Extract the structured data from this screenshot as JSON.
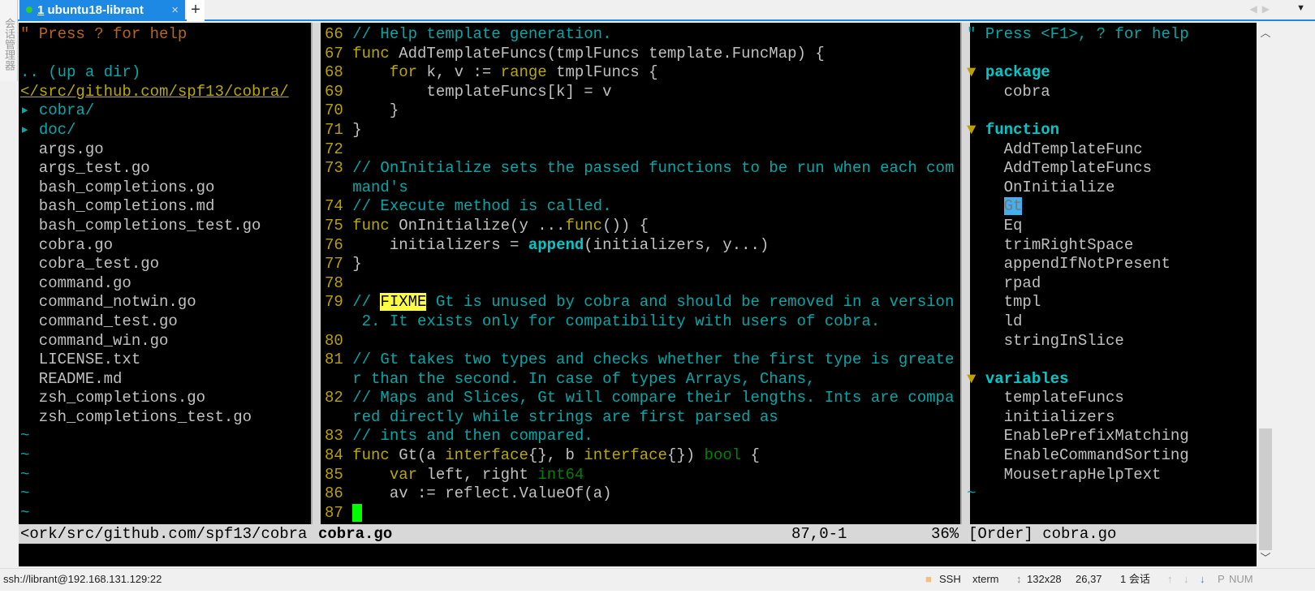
{
  "sidebar_label": "会话管理器",
  "tab": {
    "number": "1",
    "title": "ubuntu18-librant",
    "close": "×",
    "new": "+",
    "status_color": "#33cc33"
  },
  "tab_nav": {
    "prev": "◀",
    "next": "▶",
    "menu": "▼"
  },
  "left_pane": [
    [
      [
        "\" Press ? for help",
        "help"
      ]
    ],
    [],
    [
      [
        ".. (up a dir)",
        "cyan"
      ]
    ],
    [
      [
        "</src/github.com/spf13/cobra/",
        "path"
      ]
    ],
    [
      [
        "▸ ",
        "tri"
      ],
      [
        "cobra/",
        "cyan"
      ]
    ],
    [
      [
        "▸ ",
        "tri"
      ],
      [
        "doc/",
        "cyan"
      ]
    ],
    [
      [
        "  args.go",
        "norm"
      ]
    ],
    [
      [
        "  args_test.go",
        "norm"
      ]
    ],
    [
      [
        "  bash_completions.go",
        "norm"
      ]
    ],
    [
      [
        "  bash_completions.md",
        "norm"
      ]
    ],
    [
      [
        "  bash_completions_test.go",
        "norm"
      ]
    ],
    [
      [
        "  cobra.go",
        "norm"
      ]
    ],
    [
      [
        "  cobra_test.go",
        "norm"
      ]
    ],
    [
      [
        "  command.go",
        "norm"
      ]
    ],
    [
      [
        "  command_notwin.go",
        "norm"
      ]
    ],
    [
      [
        "  command_test.go",
        "norm"
      ]
    ],
    [
      [
        "  command_win.go",
        "norm"
      ]
    ],
    [
      [
        "  LICENSE.txt",
        "norm"
      ]
    ],
    [
      [
        "  README.md",
        "norm"
      ]
    ],
    [
      [
        "  zsh_completions.go",
        "norm"
      ]
    ],
    [
      [
        "  zsh_completions_test.go",
        "norm"
      ]
    ],
    [
      [
        "~",
        "tilde"
      ]
    ],
    [
      [
        "~",
        "tilde"
      ]
    ],
    [
      [
        "~",
        "tilde"
      ]
    ],
    [
      [
        "~",
        "tilde"
      ]
    ],
    [
      [
        "~",
        "tilde"
      ]
    ]
  ],
  "mid_pane": [
    [
      [
        "66 ",
        "ln"
      ],
      [
        "// Help template generation.",
        "com"
      ]
    ],
    [
      [
        "67 ",
        "ln"
      ],
      [
        "func",
        "kw"
      ],
      [
        " AddTemplateFuncs(tmplFuncs template.FuncMap) {",
        "norm"
      ]
    ],
    [
      [
        "68 ",
        "ln"
      ],
      [
        "    ",
        "norm"
      ],
      [
        "for",
        "kw"
      ],
      [
        " k, v := ",
        "norm"
      ],
      [
        "range",
        "kw"
      ],
      [
        " tmplFuncs {",
        "norm"
      ]
    ],
    [
      [
        "69 ",
        "ln"
      ],
      [
        "        templateFuncs[k] = v",
        "norm"
      ]
    ],
    [
      [
        "70 ",
        "ln"
      ],
      [
        "    }",
        "norm"
      ]
    ],
    [
      [
        "71 ",
        "ln"
      ],
      [
        "}",
        "norm"
      ]
    ],
    [
      [
        "72 ",
        "ln"
      ]
    ],
    [
      [
        "73 ",
        "ln"
      ],
      [
        "// OnInitialize sets the passed functions to be run when each com",
        "com"
      ]
    ],
    [
      [
        "   ",
        "ln"
      ],
      [
        "mand's",
        "com"
      ]
    ],
    [
      [
        "74 ",
        "ln"
      ],
      [
        "// Execute method is called.",
        "com"
      ]
    ],
    [
      [
        "75 ",
        "ln"
      ],
      [
        "func",
        "kw"
      ],
      [
        " OnInitialize(y ...",
        "norm"
      ],
      [
        "func",
        "kw"
      ],
      [
        "()) {",
        "norm"
      ]
    ],
    [
      [
        "76 ",
        "ln"
      ],
      [
        "    initializers = ",
        "norm"
      ],
      [
        "append",
        "bold"
      ],
      [
        "(initializers, y...)",
        "norm"
      ]
    ],
    [
      [
        "77 ",
        "ln"
      ],
      [
        "}",
        "norm"
      ]
    ],
    [
      [
        "78 ",
        "ln"
      ]
    ],
    [
      [
        "79 ",
        "ln"
      ],
      [
        "// ",
        "com"
      ],
      [
        "FIXME",
        "todo"
      ],
      [
        " Gt is unused by cobra and should be removed in a version",
        "com"
      ]
    ],
    [
      [
        "   ",
        "ln"
      ],
      [
        " 2. It exists only for compatibility with users of cobra.",
        "com"
      ]
    ],
    [
      [
        "80 ",
        "ln"
      ]
    ],
    [
      [
        "81 ",
        "ln"
      ],
      [
        "// Gt takes two types and checks whether the first type is greate",
        "com"
      ]
    ],
    [
      [
        "   ",
        "ln"
      ],
      [
        "r than the second. In case of types Arrays, Chans,",
        "com"
      ]
    ],
    [
      [
        "82 ",
        "ln"
      ],
      [
        "// Maps and Slices, Gt will compare their lengths. Ints are compa",
        "com"
      ]
    ],
    [
      [
        "   ",
        "ln"
      ],
      [
        "red directly while strings are first parsed as",
        "com"
      ]
    ],
    [
      [
        "83 ",
        "ln"
      ],
      [
        "// ints and then compared.",
        "com"
      ]
    ],
    [
      [
        "84 ",
        "ln"
      ],
      [
        "func",
        "kw"
      ],
      [
        " Gt(a ",
        "norm"
      ],
      [
        "interface",
        "kw"
      ],
      [
        "{}, b ",
        "norm"
      ],
      [
        "interface",
        "kw"
      ],
      [
        "{}) ",
        "norm"
      ],
      [
        "bool",
        "type"
      ],
      [
        " {",
        "norm"
      ]
    ],
    [
      [
        "85 ",
        "ln"
      ],
      [
        "    ",
        "norm"
      ],
      [
        "var",
        "kw"
      ],
      [
        " left, right ",
        "norm"
      ],
      [
        "int64",
        "type"
      ]
    ],
    [
      [
        "86 ",
        "ln"
      ],
      [
        "    av := reflect.ValueOf(a)",
        "norm"
      ]
    ],
    [
      [
        "87 ",
        "ln"
      ],
      [
        " ",
        "cur"
      ]
    ]
  ],
  "right_pane": [
    [
      [
        "\" Press <F1>, ? for help",
        "rhelp"
      ]
    ],
    [],
    [
      [
        "▼ ",
        "ytri"
      ],
      [
        "package",
        "head"
      ]
    ],
    [
      [
        "    cobra",
        "norm"
      ]
    ],
    [],
    [
      [
        "▼ ",
        "ytri"
      ],
      [
        "function",
        "head"
      ]
    ],
    [
      [
        "    AddTemplateFunc",
        "norm"
      ]
    ],
    [
      [
        "    AddTemplateFuncs",
        "norm"
      ]
    ],
    [
      [
        "    OnInitialize",
        "norm"
      ]
    ],
    [
      [
        "    ",
        "norm"
      ],
      [
        "Gt",
        "sel"
      ]
    ],
    [
      [
        "    Eq",
        "norm"
      ]
    ],
    [
      [
        "    trimRightSpace",
        "norm"
      ]
    ],
    [
      [
        "    appendIfNotPresent",
        "norm"
      ]
    ],
    [
      [
        "    rpad",
        "norm"
      ]
    ],
    [
      [
        "    tmpl",
        "norm"
      ]
    ],
    [
      [
        "    ld",
        "norm"
      ]
    ],
    [
      [
        "    stringInSlice",
        "norm"
      ]
    ],
    [],
    [
      [
        "▼ ",
        "ytri"
      ],
      [
        "variables",
        "head"
      ]
    ],
    [
      [
        "    templateFuncs",
        "norm"
      ]
    ],
    [
      [
        "    initializers",
        "norm"
      ]
    ],
    [
      [
        "    EnablePrefixMatching",
        "norm"
      ]
    ],
    [
      [
        "    EnableCommandSorting",
        "norm"
      ]
    ],
    [
      [
        "    MousetrapHelpText",
        "norm"
      ]
    ],
    [
      [
        "~",
        "tilde"
      ]
    ]
  ],
  "statusline": {
    "left_path": "<ork/src/github.com/spf13/cobra",
    "file": "cobra.go",
    "position": "87,0-1",
    "percent": "36%",
    "right": "[Order] cobra.go"
  },
  "bottombar": {
    "connection": "ssh://librant@192.168.131.129:22",
    "protocol": "SSH",
    "term_type": "xterm",
    "size": "132x28",
    "cursor": "26,37",
    "sessions": "1 会话",
    "caps": "P",
    "num": "NUM"
  }
}
